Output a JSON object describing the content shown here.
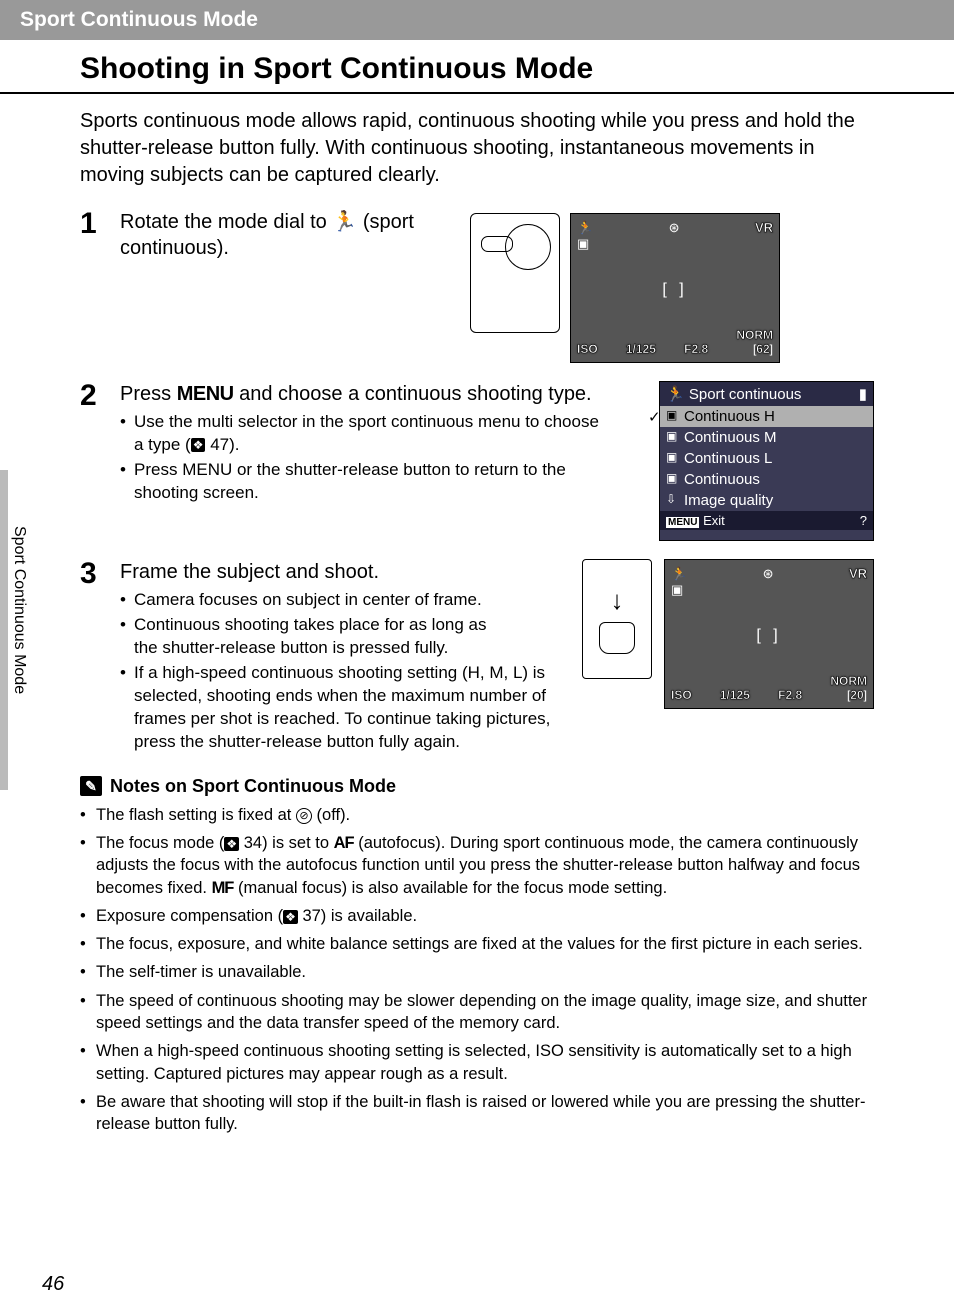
{
  "header": {
    "section": "Sport Continuous Mode"
  },
  "title": "Shooting in Sport Continuous Mode",
  "intro": "Sports continuous mode allows rapid, continuous shooting while you press and hold the shutter-release button fully. With continuous shooting, instantaneous movements in moving subjects can be captured clearly.",
  "sideTab": "Sport Continuous Mode",
  "pageNumber": "46",
  "steps": {
    "s1": {
      "num": "1",
      "head_a": "Rotate the mode dial to ",
      "head_b": " (sport continuous).",
      "lcd": {
        "shutter": "1/125",
        "aperture": "F2.8",
        "frames": "62",
        "vr": "VR",
        "iso": "ISO",
        "norm": "NORM",
        "brackets": "[   ]"
      }
    },
    "s2": {
      "num": "2",
      "head_a": "Press ",
      "menu": "MENU",
      "head_b": " and choose a continuous shooting type.",
      "b1a": "Use the multi selector in the sport continuous menu to choose a type (",
      "b1ref": " 47).",
      "b2a": "Press ",
      "b2b": " or the shutter-release button to return to the shooting screen.",
      "menuLcd": {
        "title": "Sport continuous",
        "items": [
          "Continuous H",
          "Continuous M",
          "Continuous L",
          "Continuous",
          "Image quality"
        ],
        "exit": "Exit",
        "menuLabel": "MENU"
      }
    },
    "s3": {
      "num": "3",
      "head": "Frame the subject and shoot.",
      "b1": "Camera focuses on subject in center of frame.",
      "b2": "Continuous shooting takes place for as long as the shutter-release button is pressed fully.",
      "b3": "If a high-speed continuous shooting setting (H, M, L) is selected, shooting ends when the maximum number of frames per shot is reached. To continue taking pictures, press the shutter-release button fully again.",
      "lcd": {
        "shutter": "1/125",
        "aperture": "F2.8",
        "frames": "20",
        "vr": "VR",
        "iso": "ISO",
        "norm": "NORM",
        "brackets": "[   ]"
      }
    }
  },
  "notes": {
    "title": "Notes on Sport Continuous Mode",
    "n1a": "The flash setting is fixed at ",
    "n1b": " (off).",
    "n2a": "The focus mode (",
    "n2ref": " 34) is set to ",
    "n2af": "AF",
    "n2b": " (autofocus). During sport continuous mode, the camera continuously adjusts the focus with the autofocus function until you press the shutter-release button halfway and focus becomes fixed. ",
    "n2mf": "MF",
    "n2c": " (manual focus) is also available for the focus mode setting.",
    "n3a": "Exposure compensation (",
    "n3ref": " 37) is available.",
    "n4": "The focus, exposure, and white balance settings are fixed at the values for the first picture in each series.",
    "n5": "The self-timer is unavailable.",
    "n6": "The speed of continuous shooting may be slower depending on the image quality, image size, and shutter speed settings and the data transfer speed of the memory card.",
    "n7": "When a high-speed continuous shooting setting is selected, ISO sensitivity is automatically set to a high setting. Captured pictures may appear rough as a result.",
    "n8": "Be aware that shooting will stop if the built-in flash is raised or lowered while you are pressing the shutter-release button fully."
  }
}
